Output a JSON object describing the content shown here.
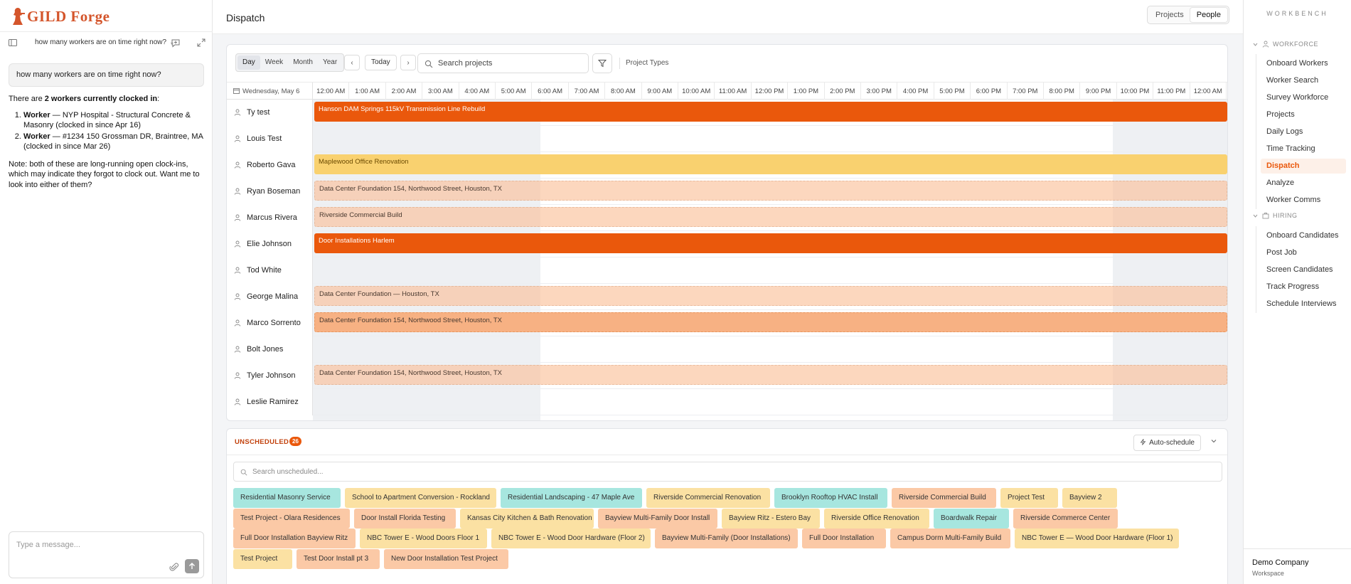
{
  "brand": {
    "name": "GILD Forge"
  },
  "chat": {
    "conversation_title": "how many workers are on time right now?",
    "user_message": "how many workers are on time right now?",
    "ai_intro_pre": "There are ",
    "ai_intro_bold": "2 workers currently clocked in",
    "ai_intro_post": ":",
    "ai_list": [
      {
        "bold": "Worker",
        "text": " — NYP Hospital - Structural Concrete & Masonry (clocked in since Apr 16)"
      },
      {
        "bold": "Worker",
        "text": " — #1234 150 Grossman DR, Braintree, MA (clocked in since Mar 26)"
      }
    ],
    "ai_note": "Note: both of these are long-running open clock-ins, which may indicate they forgot to clock out. Want me to look into either of them?",
    "composer_placeholder": "Type a message..."
  },
  "header": {
    "title": "Dispatch",
    "toggle": [
      "Projects",
      "People"
    ],
    "toggle_active": "People"
  },
  "toolbar": {
    "periods": [
      "Day",
      "Week",
      "Month",
      "Year"
    ],
    "active_period": "Day",
    "today_label": "Today",
    "search_placeholder": "Search projects",
    "project_types_label": "Project Types"
  },
  "timeline": {
    "date_label": "Wednesday, May 6",
    "hours": [
      "12:00 AM",
      "1:00 AM",
      "2:00 AM",
      "3:00 AM",
      "4:00 AM",
      "5:00 AM",
      "6:00 AM",
      "7:00 AM",
      "8:00 AM",
      "9:00 AM",
      "10:00 AM",
      "11:00 AM",
      "12:00 PM",
      "1:00 PM",
      "2:00 PM",
      "3:00 PM",
      "4:00 PM",
      "5:00 PM",
      "6:00 PM",
      "7:00 PM",
      "8:00 PM",
      "9:00 PM",
      "10:00 PM",
      "11:00 PM",
      "12:00 AM"
    ],
    "rows": [
      {
        "name": "Ty test",
        "bar": "Hanson DAM Springs 115kV Transmission Line Rebuild",
        "style": "solid"
      },
      {
        "name": "Louis Test",
        "bar": null,
        "style": null
      },
      {
        "name": "Roberto Gava",
        "bar": "Maplewood Office Renovation",
        "style": "yellow"
      },
      {
        "name": "Ryan Boseman",
        "bar": "Data Center Foundation 154, Northwood Street, Houston, TX",
        "style": "peach"
      },
      {
        "name": "Marcus Rivera",
        "bar": "Riverside Commercial Build",
        "style": "peach"
      },
      {
        "name": "Elie Johnson",
        "bar": "Door Installations Harlem",
        "style": "solid"
      },
      {
        "name": "Tod White",
        "bar": null,
        "style": null
      },
      {
        "name": "George Malina",
        "bar": "Data Center Foundation — Houston, TX",
        "style": "peach"
      },
      {
        "name": "Marco Sorrento",
        "bar": "Data Center Foundation 154, Northwood Street, Houston, TX",
        "style": "peach-strong"
      },
      {
        "name": "Bolt Jones",
        "bar": null,
        "style": null
      },
      {
        "name": "Tyler Johnson",
        "bar": "Data Center Foundation 154, Northwood Street, Houston, TX",
        "style": "peach"
      },
      {
        "name": "Leslie Ramirez",
        "bar": null,
        "style": null
      }
    ]
  },
  "unscheduled": {
    "title": "UNSCHEDULED",
    "count": "26",
    "auto_schedule_label": "Auto-schedule",
    "search_placeholder": "Search unscheduled...",
    "chip_rows": [
      [
        {
          "label": "Residential Masonry Service",
          "color": "teal"
        },
        {
          "label": "School to Apartment Conversion - Rockland",
          "color": "yellow"
        },
        {
          "label": "Residential Landscaping - 47 Maple Ave",
          "color": "teal"
        },
        {
          "label": "Riverside Commercial Renovation",
          "color": "yellow"
        },
        {
          "label": "Brooklyn Rooftop HVAC Install",
          "color": "teal"
        },
        {
          "label": "Riverside Commercial Build",
          "color": "peach"
        },
        {
          "label": "Project Test",
          "color": "yellow"
        },
        {
          "label": "Bayview 2",
          "color": "yellow"
        }
      ],
      [
        {
          "label": "Test Project - Olara Residences",
          "color": "peach"
        },
        {
          "label": "Door Install Florida Testing",
          "color": "peach"
        },
        {
          "label": "Kansas City Kitchen & Bath Renovation",
          "color": "yellow"
        },
        {
          "label": "Bayview Multi-Family Door Install",
          "color": "peach"
        },
        {
          "label": "Bayview Ritz - Estero Bay",
          "color": "yellow"
        },
        {
          "label": "Riverside Office Renovation",
          "color": "yellow"
        },
        {
          "label": "Boardwalk Repair",
          "color": "teal"
        },
        {
          "label": "Riverside Commerce Center",
          "color": "peach"
        }
      ],
      [
        {
          "label": "Full Door Installation Bayview Ritz",
          "color": "peach"
        },
        {
          "label": "NBC Tower E - Wood Doors Floor 1",
          "color": "yellow"
        },
        {
          "label": "NBC Tower E - Wood Door Hardware (Floor 2)",
          "color": "yellow"
        },
        {
          "label": "Bayview Multi-Family (Door Installations)",
          "color": "peach"
        },
        {
          "label": "Full Door Installation",
          "color": "peach"
        },
        {
          "label": "Campus Dorm Multi-Family Build",
          "color": "peach"
        },
        {
          "label": "NBC Tower E — Wood Door Hardware (Floor 1)",
          "color": "yellow"
        }
      ],
      [
        {
          "label": "Test Project",
          "color": "yellow"
        },
        {
          "label": "Test Door Install pt 3",
          "color": "peach"
        },
        {
          "label": "New Door Installation Test Project",
          "color": "peach"
        }
      ]
    ]
  },
  "sidebar": {
    "title": "WORKBENCH",
    "sections": [
      {
        "label": "WORKFORCE",
        "items": [
          "Onboard Workers",
          "Worker Search",
          "Survey Workforce",
          "Projects",
          "Daily Logs",
          "Time Tracking",
          "Dispatch",
          "Analyze",
          "Worker Comms"
        ]
      },
      {
        "label": "HIRING",
        "items": [
          "Onboard Candidates",
          "Post Job",
          "Screen Candidates",
          "Track Progress",
          "Schedule Interviews"
        ]
      }
    ],
    "active_item": "Dispatch",
    "company_name": "Demo Company",
    "company_sub": "Workspace"
  },
  "colors": {
    "accent": "#ea580c",
    "bar_yellow": "#f9d16f",
    "bar_peach": "#fbc9a6",
    "chip_teal": "#a7e6df"
  }
}
